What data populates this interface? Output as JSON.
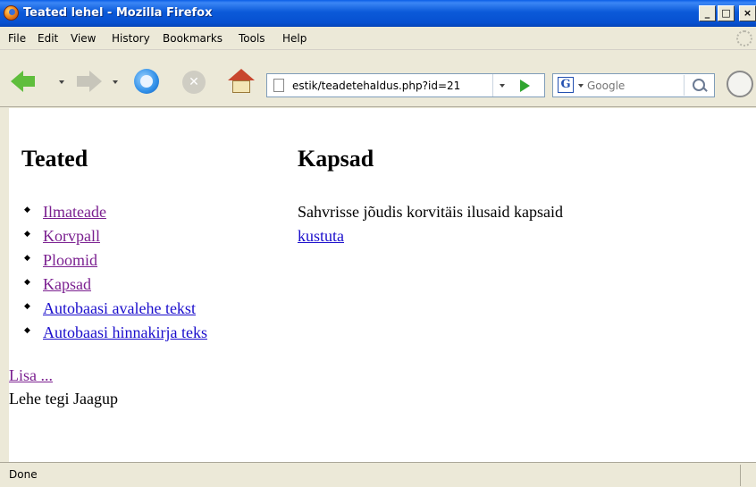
{
  "window": {
    "title": "Teated lehel - Mozilla Firefox",
    "controls": {
      "minimize": "_",
      "maximize": "□",
      "close": "×"
    }
  },
  "menu": [
    "File",
    "Edit",
    "View",
    "History",
    "Bookmarks",
    "Tools",
    "Help"
  ],
  "toolbar": {
    "url": "estik/teadetehaldus.php?id=21",
    "search_placeholder": "Google",
    "search_engine_letter": "G"
  },
  "page": {
    "sidebar_title": "Teated",
    "items": [
      {
        "label": "Ilmateade",
        "visited": true
      },
      {
        "label": "Korvpall",
        "visited": true
      },
      {
        "label": "Ploomid",
        "visited": true
      },
      {
        "label": "Kapsad",
        "visited": true
      },
      {
        "label": "Autobaasi avalehe tekst",
        "visited": false
      },
      {
        "label": "Autobaasi hinnakirja teks",
        "visited": false
      }
    ],
    "add_link": "Lisa ...",
    "footer": "Lehe tegi Jaagup",
    "main_title": "Kapsad",
    "main_text": "Sahvrisse jõudis korvitäis ilusaid kapsaid",
    "delete_link": "kustuta"
  },
  "status": {
    "text": "Done"
  },
  "icons": [
    "firefox-logo-icon",
    "back-arrow-icon",
    "forward-arrow-icon",
    "reload-icon",
    "stop-icon",
    "home-icon",
    "page-icon",
    "go-arrow-icon",
    "google-icon",
    "search-magnifier-icon",
    "clock-icon"
  ]
}
